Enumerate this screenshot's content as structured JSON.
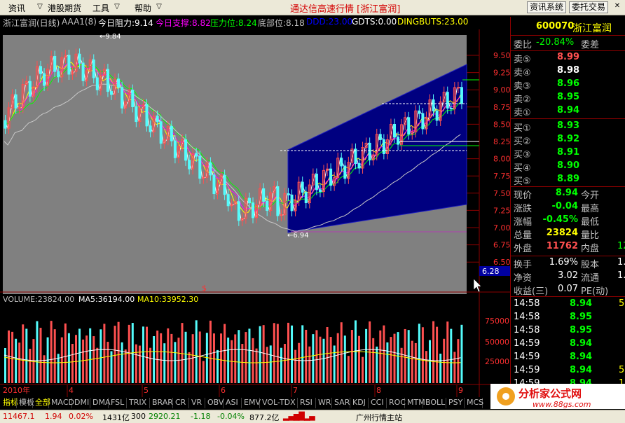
{
  "menu": {
    "items": [
      "资讯",
      "港股期货",
      "工具",
      "帮助"
    ],
    "title": "通达信高速行情 [浙江富润]",
    "right_buttons": [
      "资讯系统",
      "委托交易"
    ]
  },
  "header": {
    "name": "浙江富润(日线)",
    "indicator": "AAA1(8)",
    "resistance": "今日阻力:9.14",
    "support": "今日支撑:8.82",
    "pressure": "压力位:8.24",
    "bottom": "底部位:8.18",
    "ddd": "DDD:23.00",
    "gdts": "GDTS:0.00",
    "dingbuts": "DINGBUTS:23.00"
  },
  "price_axis": [
    "9.50",
    "9.25",
    "9.00",
    "8.75",
    "8.50",
    "8.25",
    "8.00",
    "7.75",
    "7.50",
    "7.25",
    "7.00",
    "6.75",
    "6.50"
  ],
  "current_price_tag": "6.28",
  "annotations": {
    "high": "9.84",
    "low": "6.94",
    "dollar": "$"
  },
  "volume_header": {
    "volume": "VOLUME:23824.00",
    "ma5": "MA5:36194.00",
    "ma10": "MA10:33952.30"
  },
  "volume_axis": [
    "75000",
    "50000",
    "25000"
  ],
  "x_axis": {
    "year": "2010年",
    "months": [
      "4",
      "5",
      "6",
      "7",
      "8",
      "9"
    ]
  },
  "quote": {
    "code": "600070",
    "name": "浙江富润",
    "weibi_label": "委比",
    "weibi": "-20.84%",
    "weicha_label": "委差",
    "asks": [
      {
        "label": "卖⑤",
        "price": "8.99"
      },
      {
        "label": "卖④",
        "price": "8.98"
      },
      {
        "label": "卖③",
        "price": "8.96"
      },
      {
        "label": "卖②",
        "price": "8.95"
      },
      {
        "label": "卖①",
        "price": "8.94"
      }
    ],
    "bids": [
      {
        "label": "买①",
        "price": "8.93"
      },
      {
        "label": "买②",
        "price": "8.92"
      },
      {
        "label": "买③",
        "price": "8.91"
      },
      {
        "label": "买④",
        "price": "8.90"
      },
      {
        "label": "买⑤",
        "price": "8.89"
      }
    ],
    "stats": [
      {
        "label": "现价",
        "value": "8.94",
        "label2": "今开"
      },
      {
        "label": "涨跌",
        "value": "-0.04",
        "label2": "最高"
      },
      {
        "label": "涨幅",
        "value": "-0.45%",
        "label2": "最低"
      },
      {
        "label": "总量",
        "value": "23824",
        "label2": "量比"
      },
      {
        "label": "外盘",
        "value": "11762",
        "label2": "内盘",
        "extra": "12"
      }
    ],
    "stats2": [
      {
        "label": "换手",
        "value": "1.69%",
        "label2": "股本",
        "extra": "1."
      },
      {
        "label": "净资",
        "value": "3.02",
        "label2": "流通",
        "extra": "1."
      },
      {
        "label": "收益(三)",
        "value": "0.07",
        "label2": "PE(动)"
      }
    ],
    "ticks": [
      {
        "time": "14:58",
        "price": "8.94",
        "extra": "5"
      },
      {
        "time": "14:58",
        "price": "8.95",
        "extra": ""
      },
      {
        "time": "14:58",
        "price": "8.95",
        "extra": ""
      },
      {
        "time": "14:59",
        "price": "8.94",
        "extra": ""
      },
      {
        "time": "14:59",
        "price": "8.94",
        "extra": ""
      },
      {
        "time": "14:59",
        "price": "8.94",
        "extra": "5"
      },
      {
        "time": "14:59",
        "price": "8.94",
        "extra": "1"
      }
    ]
  },
  "tabs": [
    "指标",
    "模板",
    "全部",
    "MACD",
    "DMI",
    "DMA",
    "FSL",
    "TRIX",
    "BRAR",
    "CR",
    "VR",
    "OBV",
    "ASI",
    "EMV",
    "VOL-TDX",
    "RSI",
    "WR",
    "SAR",
    "KDJ",
    "CCI",
    "ROC",
    "MTM",
    "BOLL",
    "PSY",
    "MCS"
  ],
  "status": {
    "index": "11467.1",
    "chg": "1.94",
    "pct": "0.02%",
    "amount": "1431亿",
    "code": "300",
    "idx2": "2920.21",
    "chg2": "-1.18",
    "pct2": "-0.04%",
    "amount2": "877.2亿",
    "site": "广州行情主站"
  },
  "logo": {
    "text": "分析家公式网",
    "url": "www.88gs.com"
  },
  "colors": {
    "up": "#FF5050",
    "down": "#54FCFC",
    "bg_chart": "#808080",
    "channel": "#000080"
  }
}
